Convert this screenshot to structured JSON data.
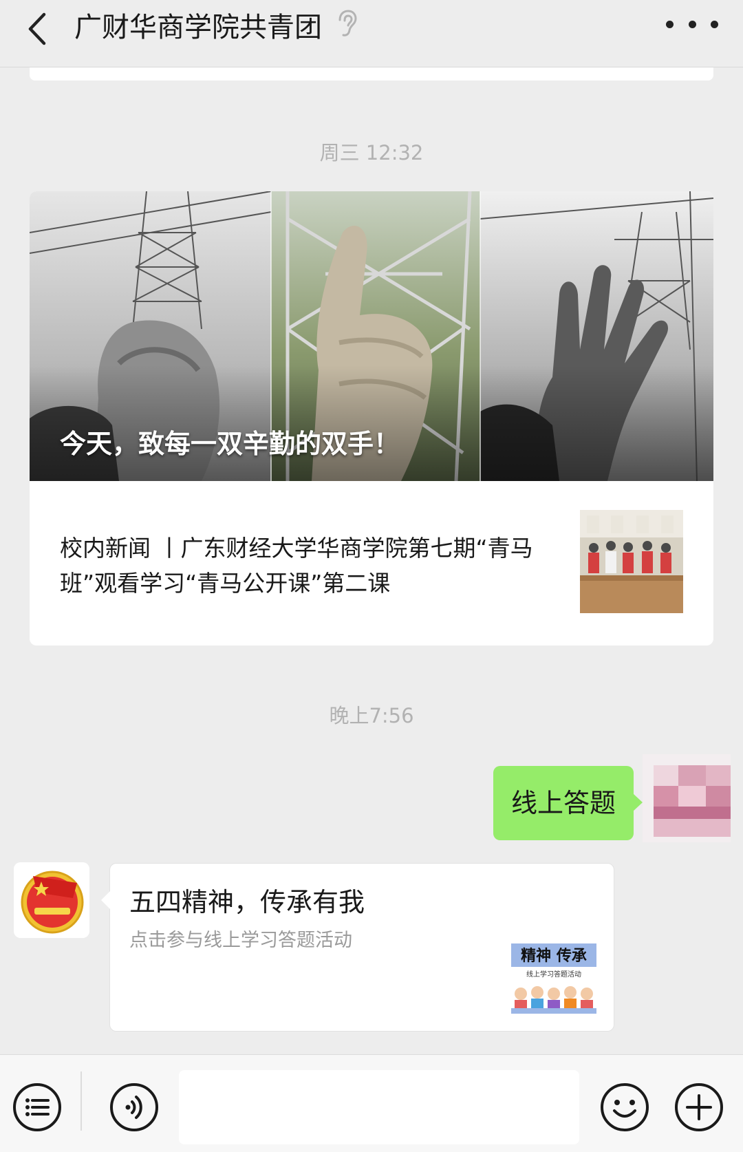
{
  "header": {
    "title": "广财华商学院共青团",
    "back_icon": "chevron-left-icon",
    "listen_icon": "ear-icon",
    "more_icon": "more-dots-icon"
  },
  "messages": {
    "timestamp_1": "周三 12:32",
    "article": {
      "cover_caption": "今天，致每一双辛勤的双手！",
      "sub_title": "校内新闻 丨广东财经大学华商学院第七期“青马班”观看学习“青马公开课”第二课"
    },
    "timestamp_2": "晚上7:56",
    "sent_text": "线上答题",
    "link_card": {
      "title": "五四精神，传承有我",
      "description": "点击参与线上学习答题活动",
      "thumb_text_main": "精神 传承",
      "thumb_text_sub": "线上学习答题活动"
    }
  },
  "input_bar": {
    "menu_icon": "menu-list-icon",
    "voice_icon": "voice-icon",
    "text_placeholder": "",
    "emoji_icon": "emoji-icon",
    "plus_icon": "plus-icon"
  },
  "colors": {
    "background": "#ededed",
    "sent_bubble": "#95ec69",
    "card": "#ffffff",
    "timestamp": "#b2b2b2"
  }
}
